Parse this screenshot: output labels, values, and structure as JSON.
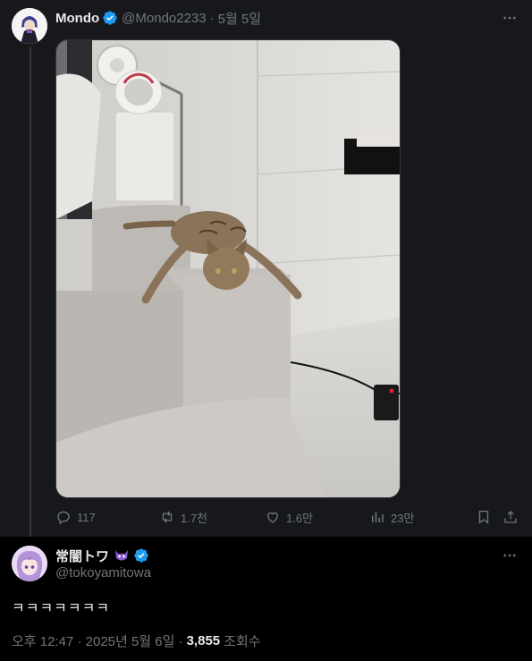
{
  "quoted_tweet": {
    "author_name": "Mondo",
    "handle": "@Mondo2233",
    "separator": "·",
    "date": "5월 5일",
    "more_icon": "more-horizontal-icon",
    "photo_alt": "cat-draped-over-sofa-arm-photo",
    "actions": {
      "replies": "117",
      "retweets": "1.7천",
      "likes": "1.6만",
      "views": "23만"
    }
  },
  "reply_tweet": {
    "author_name": "常闇トワ",
    "handle": "@tokoyamitowa",
    "text": "ㅋㅋㅋㅋㅋㅋㅋ",
    "timestamp": "오후 12:47 · 2025년 5월 6일 ·",
    "views_count": "3,855",
    "views_label": "조회수"
  },
  "colors": {
    "accent": "#1d9bf0",
    "background": "#000000",
    "quoted_background": "#16181c",
    "muted_text": "#71767b"
  }
}
